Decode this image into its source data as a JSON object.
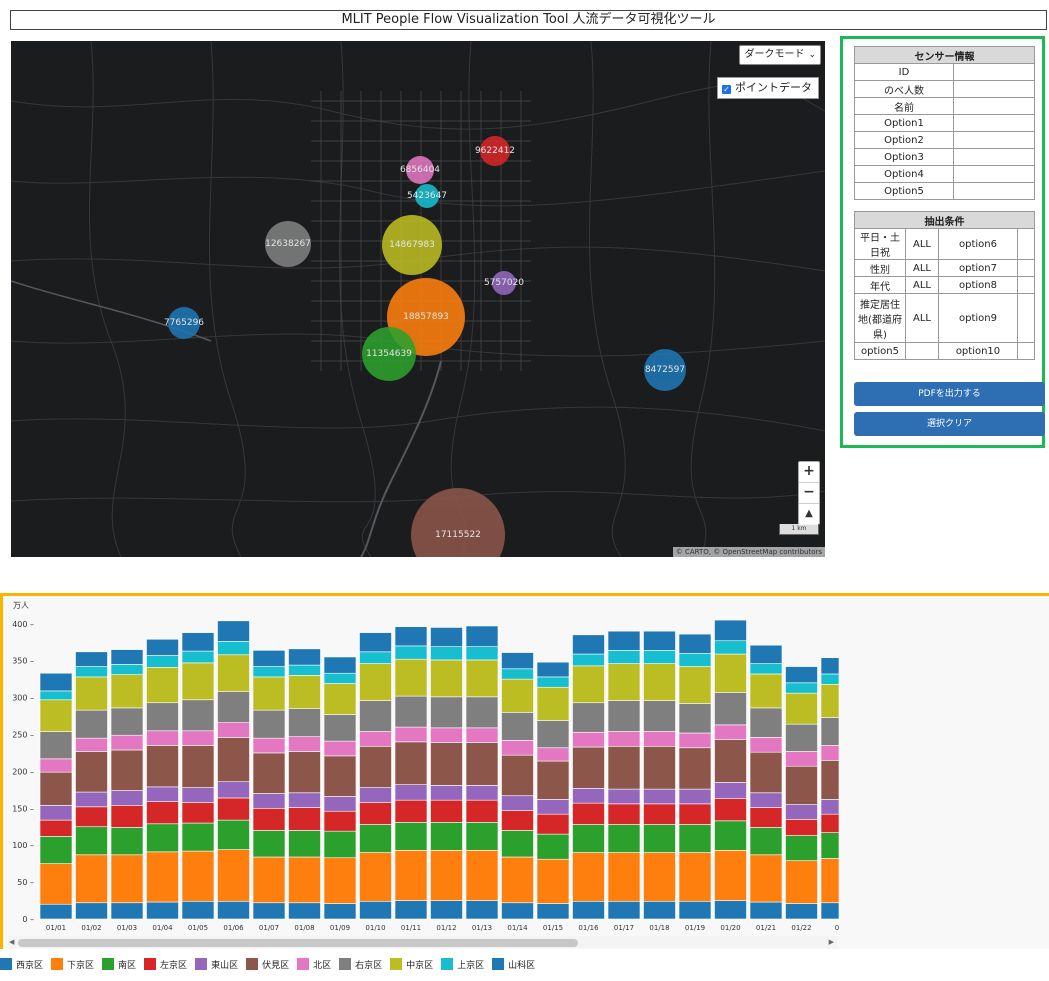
{
  "app": {
    "title": "MLIT People Flow Visualization Tool 人流データ可視化ツール"
  },
  "map": {
    "mode_select": "ダークモード",
    "point_toggle_label": "ポイントデータ",
    "point_toggle_checked": true,
    "attribution": "© CARTO, © OpenStreetMap contributors",
    "scale_label": "1 km",
    "bubbles": [
      {
        "label": "9622412",
        "color": "#d62728"
      },
      {
        "label": "6856404",
        "color": "#e377c2"
      },
      {
        "label": "5423647",
        "color": "#17becf"
      },
      {
        "label": "12638267",
        "color": "#7f7f7f"
      },
      {
        "label": "14867983",
        "color": "#bcbd22"
      },
      {
        "label": "5757020",
        "color": "#9467bd"
      },
      {
        "label": "18857893",
        "color": "#ff7f0e"
      },
      {
        "label": "7765296",
        "color": "#1f77b4"
      },
      {
        "label": "11354639",
        "color": "#2ca02c"
      },
      {
        "label": "8472597",
        "color": "#1f77b4"
      },
      {
        "label": "17115522",
        "color": "#8c564b"
      }
    ]
  },
  "sensor_info": {
    "header": "センサー情報",
    "rows": [
      "ID",
      "のべ人数",
      "名前",
      "Option1",
      "Option2",
      "Option3",
      "Option4",
      "Option5"
    ]
  },
  "conditions": {
    "header": "抽出条件",
    "rows": [
      {
        "label": "平日・土日祝",
        "value": "ALL",
        "opt": "option6"
      },
      {
        "label": "性別",
        "value": "ALL",
        "opt": "option7"
      },
      {
        "label": "年代",
        "value": "ALL",
        "opt": "option8"
      },
      {
        "label": "推定居住地(都道府県)",
        "value": "ALL",
        "opt": "option9"
      },
      {
        "label": "option5",
        "value": "",
        "opt": "option10"
      }
    ]
  },
  "buttons": {
    "pdf": "PDFを出力する",
    "clear": "選択クリア"
  },
  "chart_data": {
    "type": "bar",
    "stacked": true,
    "ylabel": "万人",
    "ylim": [
      0,
      420
    ],
    "yticks": [
      0,
      50,
      100,
      150,
      200,
      250,
      300,
      350,
      400
    ],
    "categories": [
      "01/01",
      "01/02",
      "01/03",
      "01/04",
      "01/05",
      "01/06",
      "01/07",
      "01/08",
      "01/09",
      "01/10",
      "01/11",
      "01/12",
      "01/13",
      "01/14",
      "01/15",
      "01/16",
      "01/17",
      "01/18",
      "01/19",
      "01/20",
      "01/21",
      "01/22",
      "0"
    ],
    "series": [
      {
        "name": "西京区",
        "color": "#1f77b4",
        "values": [
          20,
          22,
          22,
          23,
          24,
          24,
          22,
          22,
          21,
          24,
          25,
          25,
          25,
          22,
          21,
          24,
          24,
          24,
          24,
          25,
          23,
          21,
          22
        ]
      },
      {
        "name": "下京区",
        "color": "#ff7f0e",
        "values": [
          55,
          65,
          65,
          68,
          68,
          70,
          62,
          62,
          62,
          66,
          68,
          68,
          68,
          62,
          60,
          66,
          66,
          66,
          66,
          68,
          64,
          58,
          60
        ]
      },
      {
        "name": "南区",
        "color": "#2ca02c",
        "values": [
          37,
          38,
          37,
          38,
          38,
          40,
          36,
          36,
          36,
          38,
          38,
          38,
          38,
          36,
          34,
          38,
          38,
          38,
          38,
          40,
          37,
          34,
          35
        ]
      },
      {
        "name": "左京区",
        "color": "#d62728",
        "values": [
          22,
          27,
          30,
          30,
          28,
          30,
          30,
          31,
          27,
          30,
          30,
          30,
          30,
          27,
          27,
          29,
          28,
          28,
          28,
          30,
          27,
          22,
          25
        ]
      },
      {
        "name": "東山区",
        "color": "#9467bd",
        "values": [
          20,
          20,
          20,
          20,
          20,
          22,
          20,
          20,
          20,
          20,
          21,
          20,
          20,
          20,
          20,
          20,
          20,
          20,
          20,
          22,
          20,
          20,
          20
        ]
      },
      {
        "name": "伏見区",
        "color": "#8c564b",
        "values": [
          45,
          55,
          55,
          56,
          57,
          60,
          55,
          56,
          55,
          56,
          58,
          58,
          58,
          55,
          52,
          56,
          58,
          58,
          56,
          58,
          55,
          52,
          53
        ]
      },
      {
        "name": "北区",
        "color": "#e377c2",
        "values": [
          18,
          18,
          20,
          20,
          20,
          20,
          20,
          20,
          20,
          20,
          20,
          20,
          20,
          20,
          18,
          20,
          20,
          20,
          20,
          20,
          20,
          20,
          20
        ]
      },
      {
        "name": "右京区",
        "color": "#7f7f7f",
        "values": [
          37,
          38,
          37,
          38,
          42,
          42,
          38,
          38,
          36,
          42,
          42,
          42,
          42,
          38,
          37,
          40,
          42,
          42,
          40,
          44,
          40,
          37,
          38
        ]
      },
      {
        "name": "中京区",
        "color": "#bcbd22",
        "values": [
          43,
          45,
          45,
          48,
          50,
          50,
          45,
          45,
          42,
          50,
          50,
          50,
          50,
          45,
          45,
          50,
          50,
          50,
          50,
          52,
          46,
          42,
          45
        ]
      },
      {
        "name": "上京区",
        "color": "#17becf",
        "values": [
          12,
          14,
          14,
          16,
          16,
          18,
          14,
          14,
          14,
          16,
          18,
          18,
          18,
          14,
          14,
          16,
          18,
          18,
          18,
          18,
          14,
          14,
          14
        ]
      },
      {
        "name": "山科区",
        "color": "#1f77b4",
        "values": [
          24,
          20,
          20,
          22,
          25,
          28,
          22,
          22,
          22,
          26,
          26,
          26,
          28,
          22,
          20,
          26,
          26,
          26,
          26,
          28,
          25,
          22,
          22
        ]
      }
    ]
  }
}
